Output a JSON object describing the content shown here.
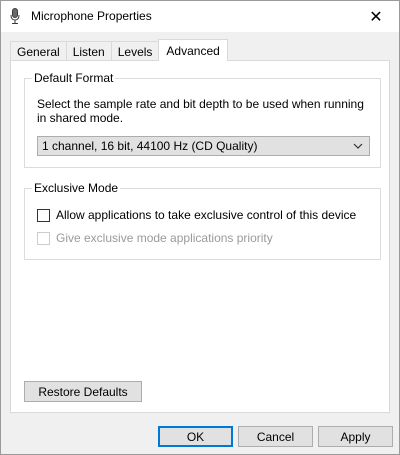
{
  "window": {
    "title": "Microphone Properties",
    "close_glyph": "✕"
  },
  "tabs": [
    {
      "label": "General",
      "active": false
    },
    {
      "label": "Listen",
      "active": false
    },
    {
      "label": "Levels",
      "active": false
    },
    {
      "label": "Advanced",
      "active": true
    }
  ],
  "default_format": {
    "group_label": "Default Format",
    "description": "Select the sample rate and bit depth to be used when running in shared mode.",
    "selected_format": "1 channel, 16 bit, 44100 Hz (CD Quality)"
  },
  "exclusive_mode": {
    "group_label": "Exclusive Mode",
    "allow_label": "Allow applications to take exclusive control of this device",
    "allow_checked": false,
    "priority_label": "Give exclusive mode applications priority",
    "priority_checked": false,
    "priority_enabled": false
  },
  "buttons": {
    "restore_defaults": "Restore Defaults",
    "ok": "OK",
    "cancel": "Cancel",
    "apply": "Apply"
  },
  "icons": {
    "window": "microphone-icon",
    "close": "close-icon",
    "dropdown": "chevron-down-icon"
  },
  "colors": {
    "accent": "#0078d7",
    "disabled_text": "#9a9a9a"
  }
}
